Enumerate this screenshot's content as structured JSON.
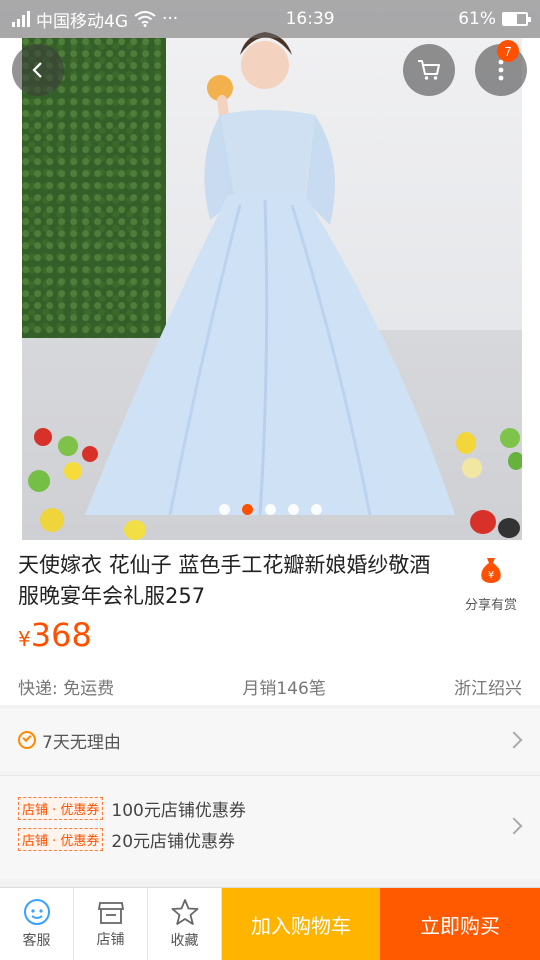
{
  "status_bar": {
    "carrier": "中国移动4G",
    "time": "16:39",
    "battery": "61%",
    "more": "···",
    "battery_level": 0.61
  },
  "header": {
    "cart_badge": "7"
  },
  "gallery": {
    "slides": 5,
    "active_index": 1
  },
  "product": {
    "title": "天使嫁衣 花仙子 蓝色手工花瓣新娘婚纱敬酒服晚宴年会礼服257",
    "share_label": "分享有赏",
    "currency": "¥",
    "price": "368",
    "shipping": "快递: 免运费",
    "monthly_sales": "月销146笔",
    "location": "浙江绍兴"
  },
  "service": {
    "label": "7天无理由"
  },
  "coupons": [
    {
      "tag": "店铺 · 优惠券",
      "text": "100元店铺优惠券"
    },
    {
      "tag": "店铺 · 优惠券",
      "text": "20元店铺优惠券"
    }
  ],
  "bottom_bar": {
    "service_label": "客服",
    "shop_label": "店铺",
    "favorite_label": "收藏",
    "add_to_cart": "加入购物车",
    "buy_now": "立即购买"
  },
  "colors": {
    "accent": "#ff5000",
    "cart_button": "#ffb400",
    "buy_button": "#ff5a00"
  }
}
